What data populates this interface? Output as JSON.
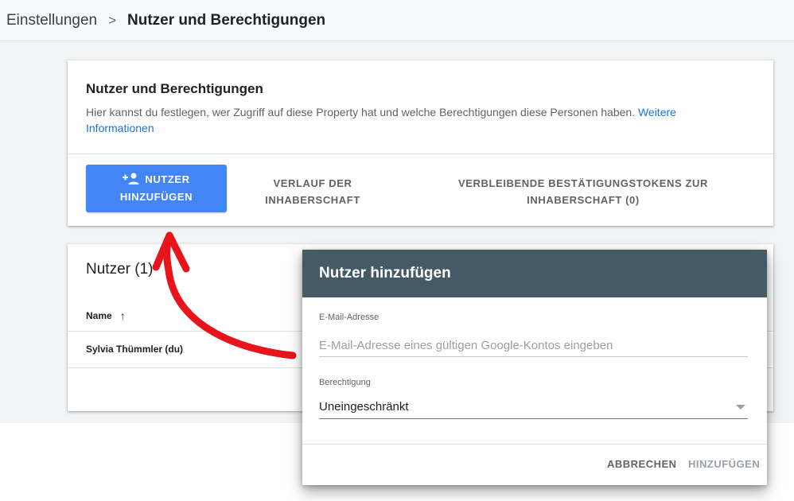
{
  "breadcrumb": {
    "root": "Einstellungen",
    "separator": ">",
    "current": "Nutzer und Berechtigungen"
  },
  "permissions_card": {
    "title": "Nutzer und Berechtigungen",
    "description": "Hier kannst du festlegen, wer Zugriff auf diese Property hat und welche Berechtigungen diese Personen haben.",
    "more_link": "Weitere Informationen",
    "add_user_button": "NUTZER HINZUFÜGEN",
    "add_user_icon": "person-add-icon",
    "tabs": [
      {
        "label": "VERLAUF DER INHABERSCHAFT"
      },
      {
        "label": "VERBLEIBENDE BESTÄTIGUNGSTOKENS ZUR INHABERSCHAFT (0)"
      }
    ]
  },
  "users_card": {
    "title": "Nutzer (1)",
    "column_name": "Name",
    "sort_icon": "arrow-up-icon",
    "rows": [
      {
        "name": "Sylvia Thümmler (du)"
      }
    ]
  },
  "dialog": {
    "title": "Nutzer hinzufügen",
    "email_label": "E-Mail-Adresse",
    "email_placeholder": "E-Mail-Adresse eines gültigen Google-Kontos eingeben",
    "email_value": "",
    "permission_label": "Berechtigung",
    "permission_value": "Uneingeschränkt",
    "cancel_button": "ABBRECHEN",
    "submit_button": "HINZUFÜGEN"
  },
  "colors": {
    "primary_button": "#4285f4",
    "dialog_header": "#455a64",
    "link": "#1a73e8",
    "annotation_arrow": "#e8141b"
  }
}
